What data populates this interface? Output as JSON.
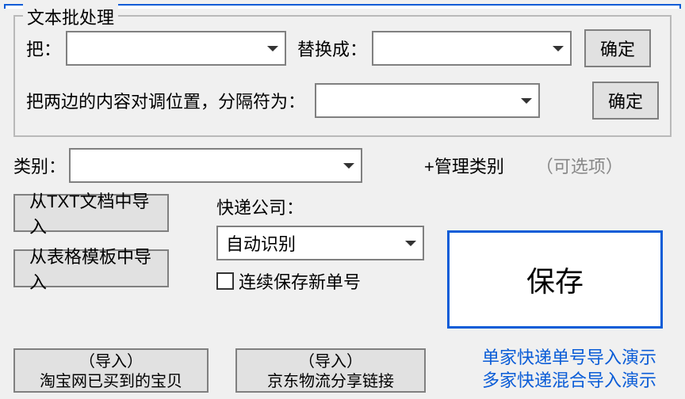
{
  "text_batch": {
    "legend": "文本批处理",
    "replace_from_label": "把：",
    "replace_to_label": "替换成：",
    "confirm": "确定",
    "swap_label": "把两边的内容对调位置，分隔符为："
  },
  "category": {
    "label": "类别：",
    "manage_link": "+管理类别",
    "optional": "（可选项）"
  },
  "import": {
    "from_txt": "从TXT文档中导入",
    "from_table": "从表格模板中导入",
    "express_label": "快递公司：",
    "express_value": "自动识别",
    "keep_saving_new": "连续保存新单号"
  },
  "save_label": "保存",
  "bottom": {
    "import_tag": "（导入）",
    "taobao": "淘宝网已买到的宝贝",
    "jd": "京东物流分享链接"
  },
  "links": {
    "single": "单家快递单号导入演示",
    "multi": "多家快递混合导入演示"
  }
}
